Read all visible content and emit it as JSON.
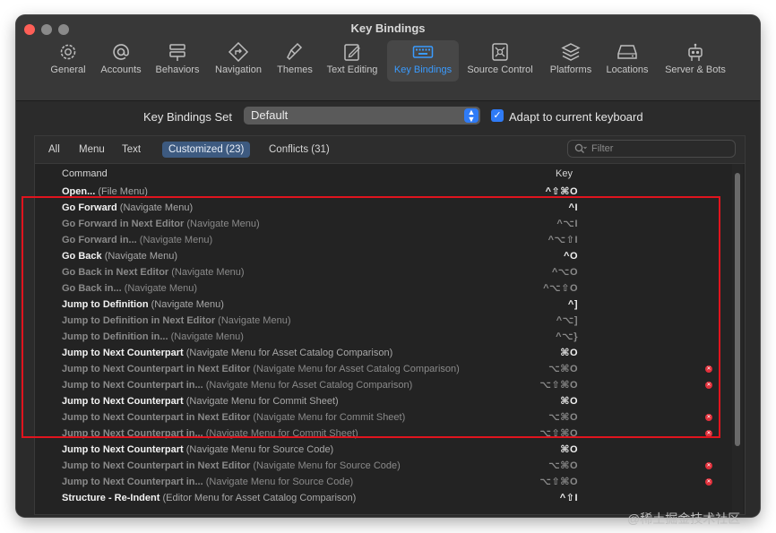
{
  "window": {
    "title": "Key Bindings"
  },
  "toolbar": {
    "items": [
      {
        "label": "General",
        "icon": "gear-icon"
      },
      {
        "label": "Accounts",
        "icon": "at-sign-icon"
      },
      {
        "label": "Behaviors",
        "icon": "behaviors-icon"
      },
      {
        "label": "Navigation",
        "icon": "navigation-icon"
      },
      {
        "label": "Themes",
        "icon": "paintbrush-icon"
      },
      {
        "label": "Text Editing",
        "icon": "text-editing-icon"
      },
      {
        "label": "Key Bindings",
        "icon": "keyboard-icon",
        "active": true
      },
      {
        "label": "Source Control",
        "icon": "source-control-icon"
      },
      {
        "label": "Platforms",
        "icon": "stack-icon"
      },
      {
        "label": "Locations",
        "icon": "disk-icon"
      },
      {
        "label": "Server & Bots",
        "icon": "robot-icon"
      }
    ]
  },
  "key_bindings_set": {
    "label": "Key Bindings Set",
    "value": "Default"
  },
  "adapt": {
    "label": "Adapt to current keyboard",
    "checked": true
  },
  "filter_tabs": [
    {
      "label": "All"
    },
    {
      "label": "Menu"
    },
    {
      "label": "Text"
    },
    {
      "label": "Customized (23)",
      "active": true
    },
    {
      "label": "Conflicts (31)"
    }
  ],
  "search": {
    "placeholder": "Filter"
  },
  "table": {
    "headers": {
      "command": "Command",
      "key": "Key"
    },
    "rows": [
      {
        "name": "Open...",
        "context": "(File Menu)",
        "key": "^⇧⌘O",
        "dim": false,
        "conflict": false
      },
      {
        "name": "Go Forward",
        "context": "(Navigate Menu)",
        "key": "^I",
        "dim": false,
        "conflict": false
      },
      {
        "name": "Go Forward in Next Editor",
        "context": "(Navigate Menu)",
        "key": "^⌥I",
        "dim": true,
        "conflict": false
      },
      {
        "name": "Go Forward in...",
        "context": "(Navigate Menu)",
        "key": "^⌥⇧I",
        "dim": true,
        "conflict": false
      },
      {
        "name": "Go Back",
        "context": "(Navigate Menu)",
        "key": "^O",
        "dim": false,
        "conflict": false
      },
      {
        "name": "Go Back in Next Editor",
        "context": "(Navigate Menu)",
        "key": "^⌥O",
        "dim": true,
        "conflict": false
      },
      {
        "name": "Go Back in...",
        "context": "(Navigate Menu)",
        "key": "^⌥⇧O",
        "dim": true,
        "conflict": false
      },
      {
        "name": "Jump to Definition",
        "context": "(Navigate Menu)",
        "key": "^]",
        "dim": false,
        "conflict": false
      },
      {
        "name": "Jump to Definition in Next Editor",
        "context": "(Navigate Menu)",
        "key": "^⌥]",
        "dim": true,
        "conflict": false
      },
      {
        "name": "Jump to Definition in...",
        "context": "(Navigate Menu)",
        "key": "^⌥}",
        "dim": true,
        "conflict": false
      },
      {
        "name": "Jump to Next Counterpart",
        "context": "(Navigate Menu for Asset Catalog Comparison)",
        "key": "⌘O",
        "dim": false,
        "conflict": false
      },
      {
        "name": "Jump to Next Counterpart in Next Editor",
        "context": "(Navigate Menu for Asset Catalog Comparison)",
        "key": "⌥⌘O",
        "dim": true,
        "conflict": true
      },
      {
        "name": "Jump to Next Counterpart in...",
        "context": "(Navigate Menu for Asset Catalog Comparison)",
        "key": "⌥⇧⌘O",
        "dim": true,
        "conflict": true
      },
      {
        "name": "Jump to Next Counterpart",
        "context": "(Navigate Menu for Commit Sheet)",
        "key": "⌘O",
        "dim": false,
        "conflict": false
      },
      {
        "name": "Jump to Next Counterpart in Next Editor",
        "context": "(Navigate Menu for Commit Sheet)",
        "key": "⌥⌘O",
        "dim": true,
        "conflict": true
      },
      {
        "name": "Jump to Next Counterpart in...",
        "context": "(Navigate Menu for Commit Sheet)",
        "key": "⌥⇧⌘O",
        "dim": true,
        "conflict": true
      },
      {
        "name": "Jump to Next Counterpart",
        "context": "(Navigate Menu for Source Code)",
        "key": "⌘O",
        "dim": false,
        "conflict": false
      },
      {
        "name": "Jump to Next Counterpart in Next Editor",
        "context": "(Navigate Menu for Source Code)",
        "key": "⌥⌘O",
        "dim": true,
        "conflict": true
      },
      {
        "name": "Jump to Next Counterpart in...",
        "context": "(Navigate Menu for Source Code)",
        "key": "⌥⇧⌘O",
        "dim": true,
        "conflict": true
      },
      {
        "name": "Structure - Re-Indent",
        "context": "(Editor Menu for Asset Catalog Comparison)",
        "key": "^⇧I",
        "dim": false,
        "conflict": false
      }
    ]
  },
  "watermark": "@稀土掘金技术社区",
  "colors": {
    "accent": "#2f7bf6",
    "conflict": "#e2313c",
    "highlight": "#e0141e"
  }
}
